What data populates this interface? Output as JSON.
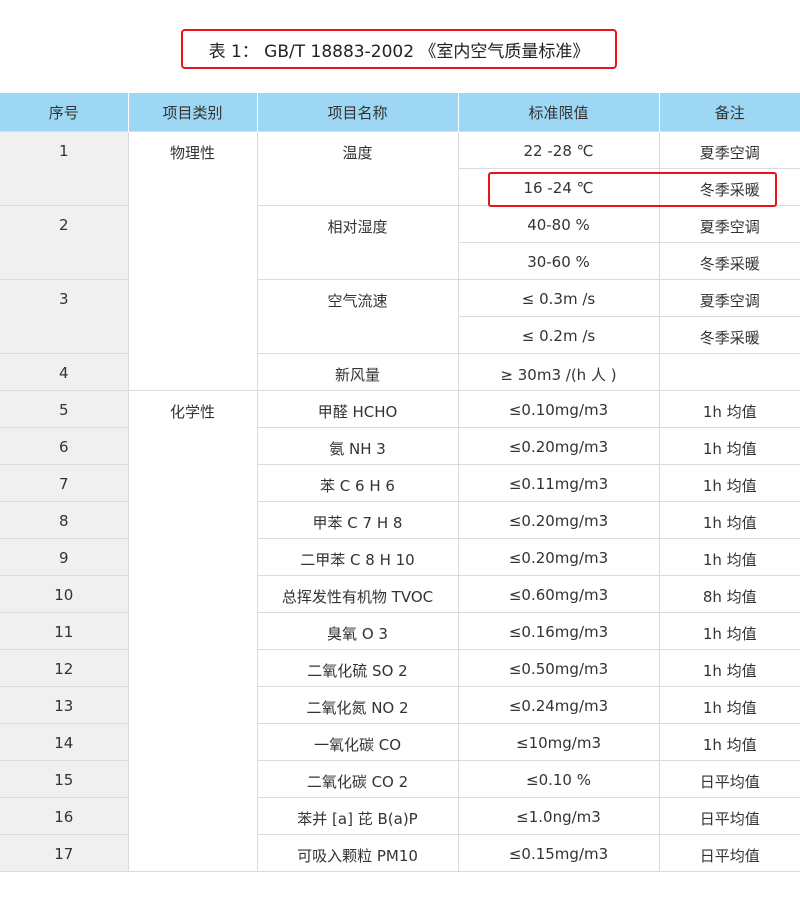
{
  "title": "表 1： GB/T 18883-2002 《室内空气质量标准》",
  "headers": [
    "序号",
    "项目类别",
    "项目名称",
    "标准限值",
    "备注"
  ],
  "rows": [
    {
      "seq": "1",
      "category": "物理性",
      "name": "温度",
      "limit": "22 -28 ℃",
      "note": "夏季空调"
    },
    {
      "seq": "",
      "category": "",
      "name": "",
      "limit": "16 -24 ℃",
      "note": "冬季采暖"
    },
    {
      "seq": "2",
      "category": "",
      "name": "相对湿度",
      "limit": "40-80 %",
      "note": "夏季空调"
    },
    {
      "seq": "",
      "category": "",
      "name": "",
      "limit": "30-60 %",
      "note": "冬季采暖"
    },
    {
      "seq": "3",
      "category": "",
      "name": "空气流速",
      "limit": "≤ 0.3m /s",
      "note": "夏季空调"
    },
    {
      "seq": "",
      "category": "",
      "name": "",
      "limit": "≤ 0.2m /s",
      "note": "冬季采暖"
    },
    {
      "seq": "4",
      "category": "",
      "name": "新风量",
      "limit": "≥ 30m3 /(h 人 )",
      "note": ""
    },
    {
      "seq": "5",
      "category": "化学性",
      "name": "甲醛 HCHO",
      "limit": "≤0.10mg/m3",
      "note": "1h 均值"
    },
    {
      "seq": "6",
      "category": "",
      "name": "氨 NH 3",
      "limit": "≤0.20mg/m3",
      "note": "1h 均值"
    },
    {
      "seq": "7",
      "category": "",
      "name": "苯 C 6 H 6",
      "limit": "≤0.11mg/m3",
      "note": "1h 均值"
    },
    {
      "seq": "8",
      "category": "",
      "name": "甲苯 C 7 H 8",
      "limit": "≤0.20mg/m3",
      "note": "1h 均值"
    },
    {
      "seq": "9",
      "category": "",
      "name": "二甲苯 C 8 H 10",
      "limit": "≤0.20mg/m3",
      "note": "1h 均值"
    },
    {
      "seq": "10",
      "category": "",
      "name": "总挥发性有机物 TVOC",
      "limit": "≤0.60mg/m3",
      "note": "8h 均值"
    },
    {
      "seq": "11",
      "category": "",
      "name": "臭氧 O 3",
      "limit": "≤0.16mg/m3",
      "note": "1h 均值"
    },
    {
      "seq": "12",
      "category": "",
      "name": "二氧化硫 SO 2",
      "limit": "≤0.50mg/m3",
      "note": "1h 均值"
    },
    {
      "seq": "13",
      "category": "",
      "name": "二氧化氮 NO 2",
      "limit": "≤0.24mg/m3",
      "note": "1h 均值"
    },
    {
      "seq": "14",
      "category": "",
      "name": "一氧化碳 CO",
      "limit": "≤10mg/m3",
      "note": "1h 均值"
    },
    {
      "seq": "15",
      "category": "",
      "name": "二氧化碳 CO 2",
      "limit": "≤0.10 %",
      "note": "日平均值"
    },
    {
      "seq": "16",
      "category": "",
      "name": "苯并 [a] 芘 B(a)P",
      "limit": "≤1.0ng/m3",
      "note": "日平均值"
    },
    {
      "seq": "17",
      "category": "",
      "name": "可吸入颗粒 PM10",
      "limit": "≤0.15mg/m3",
      "note": "日平均值"
    }
  ],
  "highlight_colour": "#e8141b",
  "header_colour": "#9ed7f3"
}
